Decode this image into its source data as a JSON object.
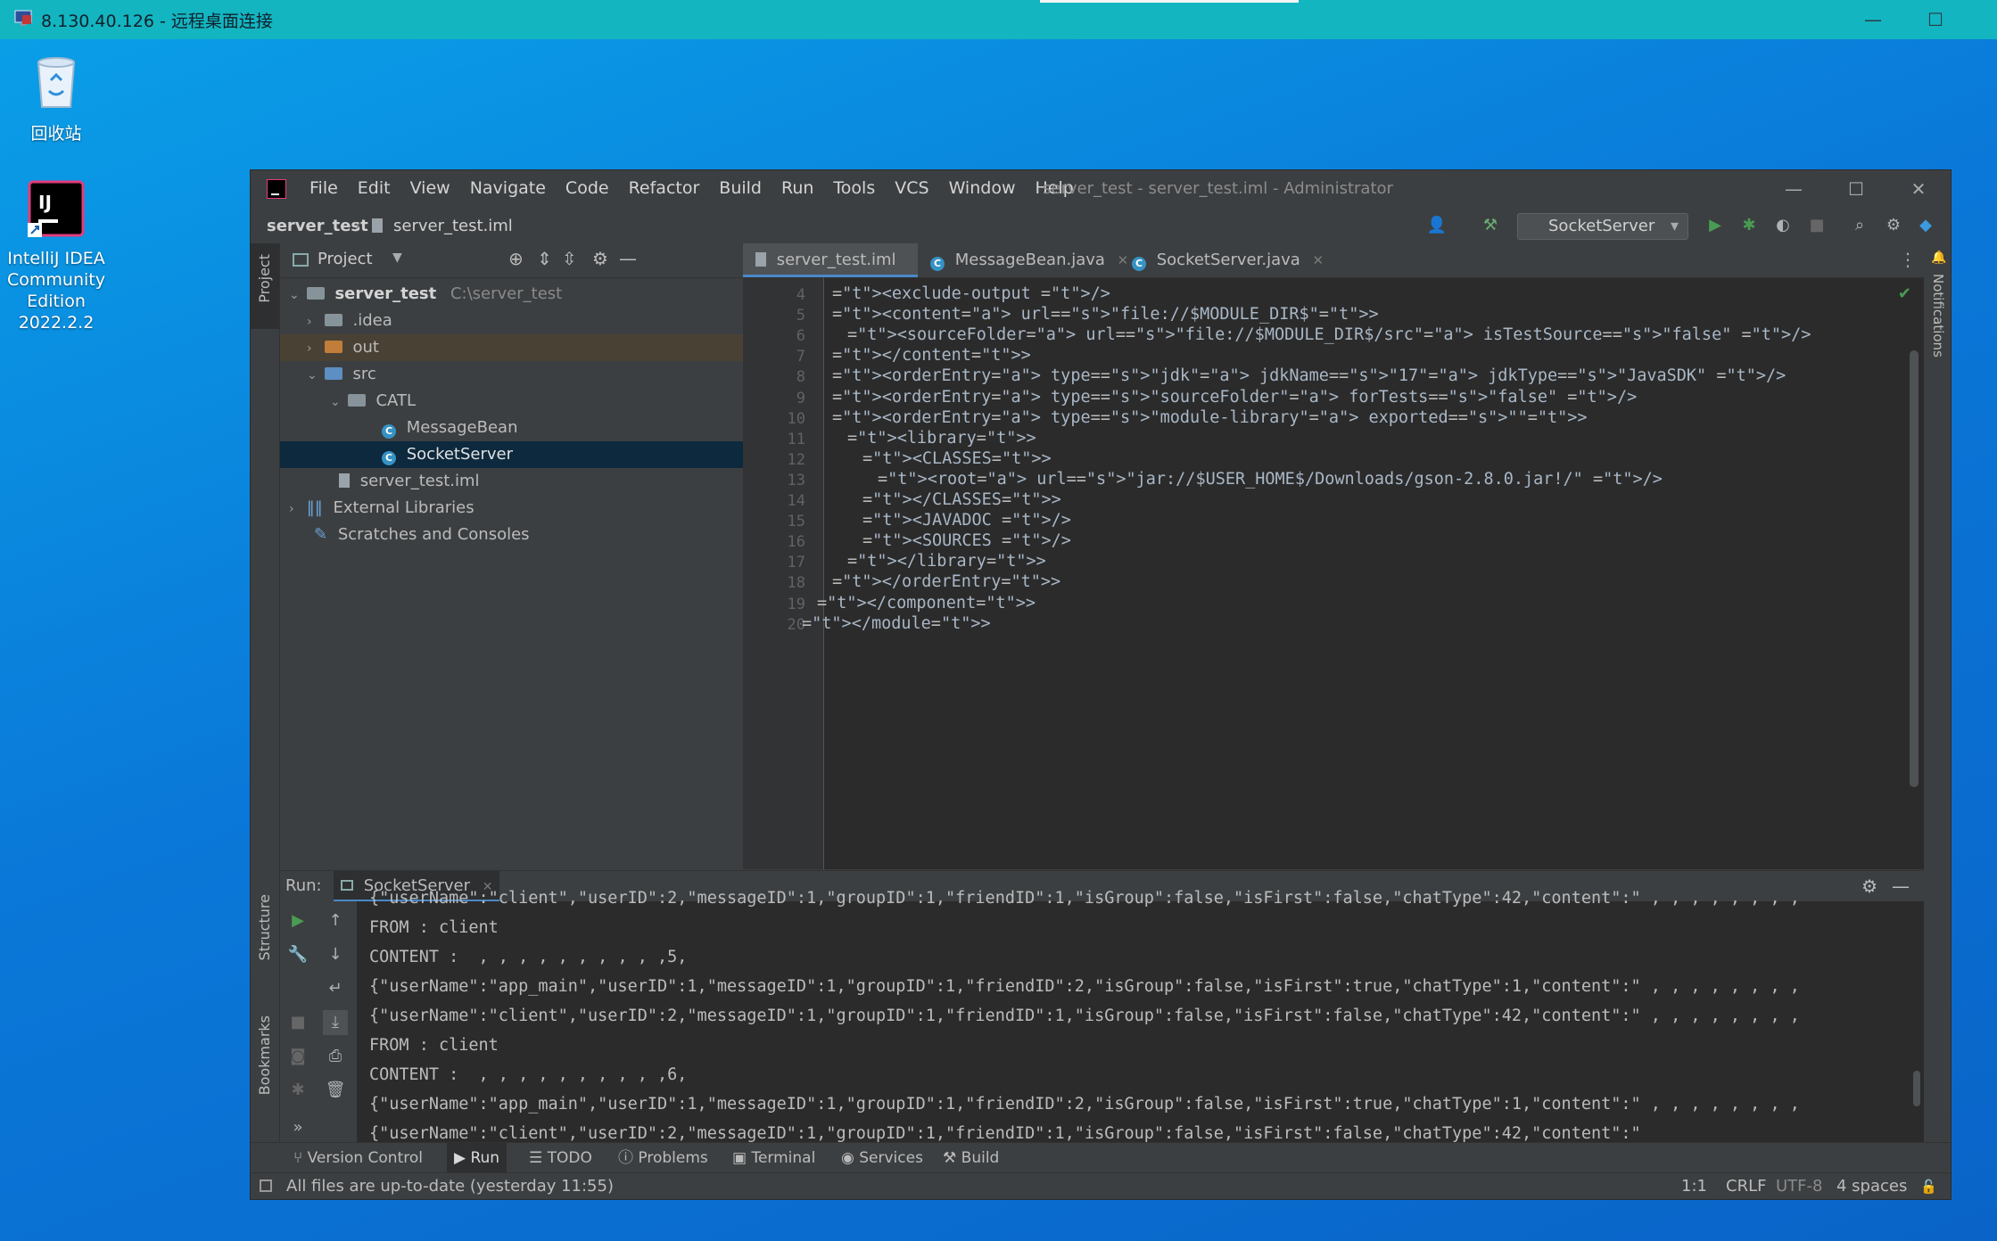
{
  "rdp": {
    "title": "8.130.40.126 - 远程桌面连接"
  },
  "desktop": {
    "recycle_bin": "回收站",
    "idea_shortcut_lines": [
      "IntelliJ IDEA",
      "Community",
      "Edition",
      "2022.2.2"
    ]
  },
  "ide": {
    "menu": [
      "File",
      "Edit",
      "View",
      "Navigate",
      "Code",
      "Refactor",
      "Build",
      "Run",
      "Tools",
      "VCS",
      "Window",
      "Help"
    ],
    "window_title": "server_test - server_test.iml - Administrator",
    "breadcrumb": [
      "server_test",
      "server_test.iml"
    ],
    "run_config": "SocketServer",
    "project_panel": {
      "title": "Project",
      "tree": [
        {
          "label": "server_test",
          "path": "C:\\server_test",
          "depth": 0,
          "expanded": true,
          "kind": "module"
        },
        {
          "label": ".idea",
          "depth": 1,
          "expanded": false,
          "kind": "folder"
        },
        {
          "label": "out",
          "depth": 1,
          "expanded": false,
          "kind": "folder-excluded"
        },
        {
          "label": "src",
          "depth": 1,
          "expanded": true,
          "kind": "folder-source"
        },
        {
          "label": "CATL",
          "depth": 2,
          "expanded": true,
          "kind": "package"
        },
        {
          "label": "MessageBean",
          "depth": 3,
          "kind": "class"
        },
        {
          "label": "SocketServer",
          "depth": 3,
          "kind": "class",
          "selected": true
        },
        {
          "label": "server_test.iml",
          "depth": 2,
          "kind": "file"
        },
        {
          "label": "External Libraries",
          "depth": 0,
          "expanded": false,
          "kind": "library"
        },
        {
          "label": "Scratches and Consoles",
          "depth": 0,
          "kind": "scratches"
        }
      ]
    },
    "editor_tabs": [
      {
        "label": "server_test.iml",
        "active": true
      },
      {
        "label": "MessageBean.java",
        "active": false
      },
      {
        "label": "SocketServer.java",
        "active": false
      }
    ],
    "code_lines": [
      {
        "n": "4",
        "indent": 2,
        "text": "<exclude-output />"
      },
      {
        "n": "5",
        "indent": 2,
        "text": "<content url=\"file://$MODULE_DIR$\">"
      },
      {
        "n": "6",
        "indent": 3,
        "text": "<sourceFolder url=\"file://$MODULE_DIR$/src\" isTestSource=\"false\" />"
      },
      {
        "n": "7",
        "indent": 2,
        "text": "</content>"
      },
      {
        "n": "8",
        "indent": 2,
        "text": "<orderEntry type=\"jdk\" jdkName=\"17\" jdkType=\"JavaSDK\" />"
      },
      {
        "n": "9",
        "indent": 2,
        "text": "<orderEntry type=\"sourceFolder\" forTests=\"false\" />"
      },
      {
        "n": "10",
        "indent": 2,
        "text": "<orderEntry type=\"module-library\" exported=\"\">"
      },
      {
        "n": "11",
        "indent": 3,
        "text": "<library>"
      },
      {
        "n": "12",
        "indent": 4,
        "text": "<CLASSES>"
      },
      {
        "n": "13",
        "indent": 5,
        "text": "<root url=\"jar://$USER_HOME$/Downloads/gson-2.8.0.jar!/\" />"
      },
      {
        "n": "14",
        "indent": 4,
        "text": "</CLASSES>"
      },
      {
        "n": "15",
        "indent": 4,
        "text": "<JAVADOC />"
      },
      {
        "n": "16",
        "indent": 4,
        "text": "<SOURCES />"
      },
      {
        "n": "17",
        "indent": 3,
        "text": "</library>"
      },
      {
        "n": "18",
        "indent": 2,
        "text": "</orderEntry>"
      },
      {
        "n": "19",
        "indent": 1,
        "text": "</component>"
      },
      {
        "n": "20",
        "indent": 0,
        "text": "</module>"
      }
    ],
    "run_panel": {
      "label": "Run:",
      "tab": "SocketServer",
      "console": [
        "{\"userName\":\"client\",\"userID\":2,\"messageID\":1,\"groupID\":1,\"friendID\":1,\"isGroup\":false,\"isFirst\":false,\"chatType\":42,\"content\":\" , , , , , , , ,",
        "FROM : client",
        "CONTENT :  , , , , , , , , , ,5,",
        "{\"userName\":\"app_main\",\"userID\":1,\"messageID\":1,\"groupID\":1,\"friendID\":2,\"isGroup\":false,\"isFirst\":true,\"chatType\":1,\"content\":\" , , , , , , , ,",
        "{\"userName\":\"client\",\"userID\":2,\"messageID\":1,\"groupID\":1,\"friendID\":1,\"isGroup\":false,\"isFirst\":false,\"chatType\":42,\"content\":\" , , , , , , , ,",
        "FROM : client",
        "CONTENT :  , , , , , , , , , ,6,",
        "{\"userName\":\"app_main\",\"userID\":1,\"messageID\":1,\"groupID\":1,\"friendID\":2,\"isGroup\":false,\"isFirst\":true,\"chatType\":1,\"content\":\" , , , , , , , ,",
        "{\"userName\":\"client\",\"userID\":2,\"messageID\":1,\"groupID\":1,\"friendID\":1,\"isGroup\":false,\"isFirst\":false,\"chatType\":42,\"content\":\""
      ]
    },
    "left_stripe": {
      "project": "Project",
      "structure": "Structure",
      "bookmarks": "Bookmarks"
    },
    "right_stripe": {
      "notifications": "Notifications"
    },
    "tool_windows": [
      "Version Control",
      "Run",
      "TODO",
      "Problems",
      "Terminal",
      "Services",
      "Build"
    ],
    "status": {
      "message": "All files are up-to-date (yesterday 11:55)",
      "position": "1:1",
      "line_sep": "CRLF",
      "encoding": "UTF-8",
      "indent": "4 spaces"
    }
  },
  "colors": {
    "accent": "#4a88c7",
    "tag": "#e8bf6a",
    "string": "#6a8759",
    "rdp_bar": "#13b5c1"
  }
}
